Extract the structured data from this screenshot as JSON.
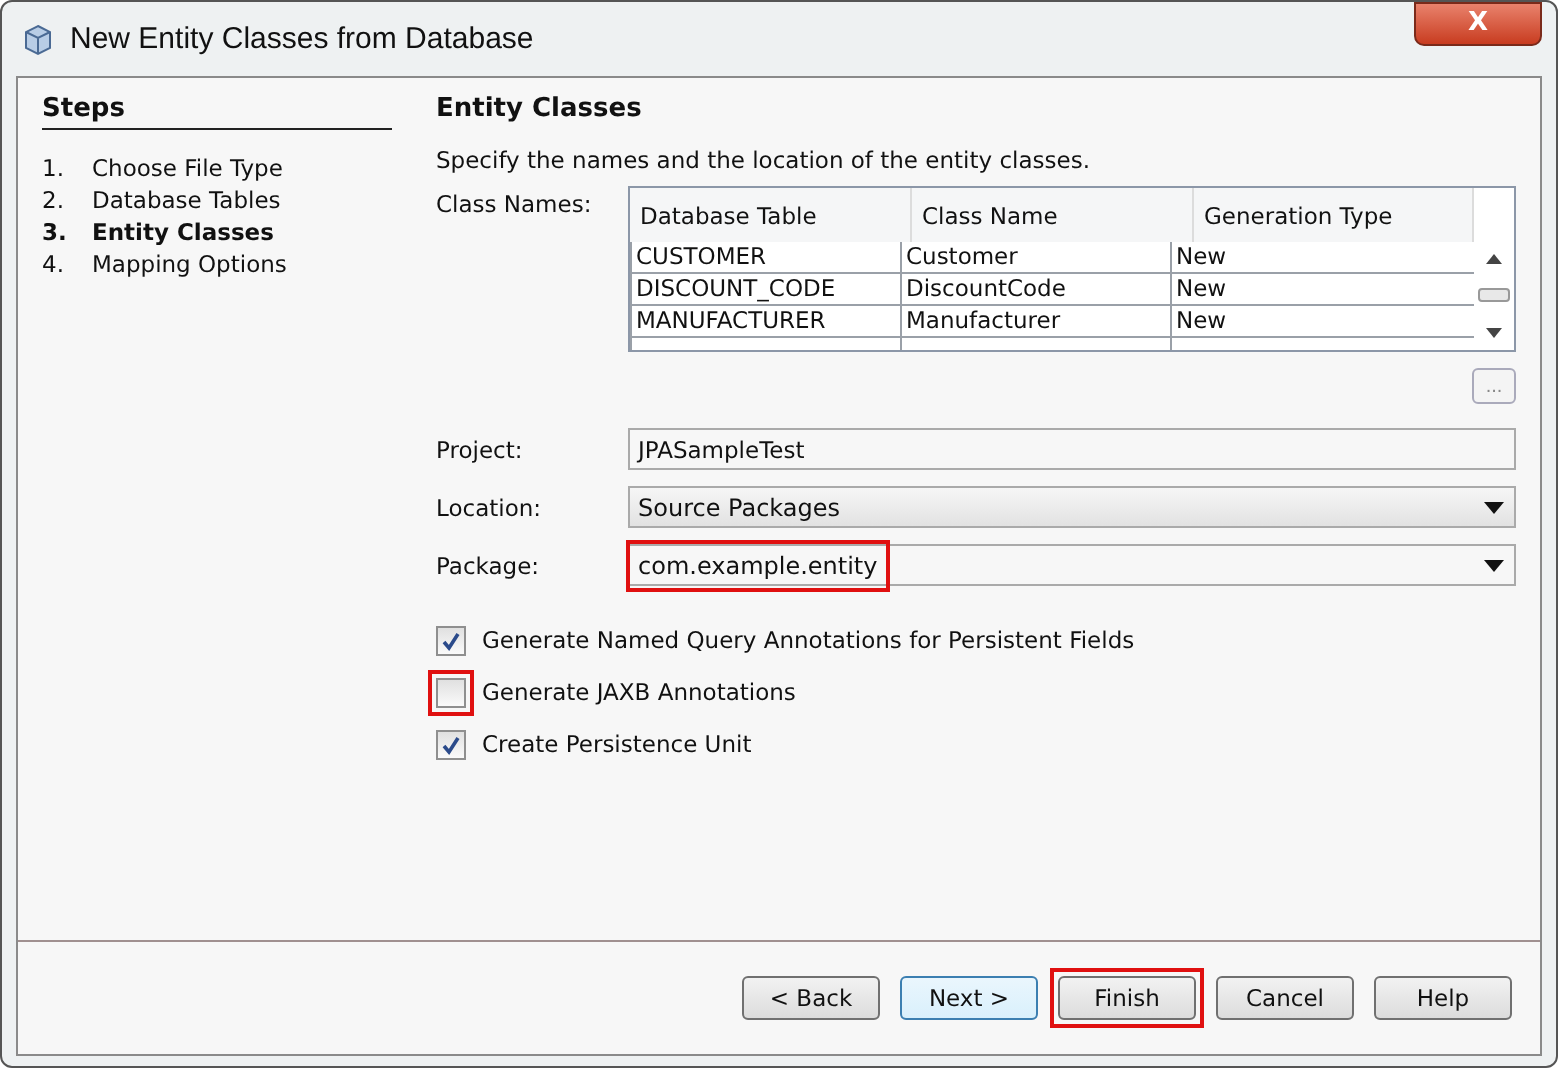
{
  "window": {
    "title": "New Entity Classes from Database",
    "close_label": "X"
  },
  "steps": {
    "title": "Steps",
    "items": [
      {
        "number": "1.",
        "label": "Choose File Type",
        "selected": false
      },
      {
        "number": "2.",
        "label": "Database Tables",
        "selected": false
      },
      {
        "number": "3.",
        "label": "Entity Classes",
        "selected": true
      },
      {
        "number": "4.",
        "label": "Mapping Options",
        "selected": false
      }
    ]
  },
  "content": {
    "title": "Entity Classes",
    "description": "Specify the names and the location of the entity classes.",
    "class_names_label": "Class Names:",
    "table": {
      "columns": [
        "Database Table",
        "Class Name",
        "Generation Type"
      ],
      "rows": [
        [
          "CUSTOMER",
          "Customer",
          "New"
        ],
        [
          "DISCOUNT_CODE",
          "DiscountCode",
          "New"
        ],
        [
          "MANUFACTURER",
          "Manufacturer",
          "New"
        ]
      ]
    },
    "more_button": "...",
    "fields": [
      {
        "kind": "text",
        "label": "Project:",
        "value": "JPASampleTest"
      },
      {
        "kind": "combo",
        "label": "Location:",
        "value": "Source Packages"
      },
      {
        "kind": "editable-combo",
        "label": "Package:",
        "value": "com.example.entity",
        "highlighted": true
      }
    ],
    "checkboxes": [
      {
        "label": "Generate Named Query Annotations for Persistent Fields",
        "checked": true,
        "highlighted": false
      },
      {
        "label": "Generate JAXB Annotations",
        "checked": false,
        "highlighted": true
      },
      {
        "label": "Create Persistence Unit",
        "checked": true,
        "highlighted": false
      }
    ]
  },
  "buttons": [
    {
      "label": "< Back",
      "focused": false,
      "highlighted": false
    },
    {
      "label": "Next >",
      "focused": true,
      "highlighted": false
    },
    {
      "label": "Finish",
      "focused": false,
      "highlighted": true
    },
    {
      "label": "Cancel",
      "focused": false,
      "highlighted": false
    },
    {
      "label": "Help",
      "focused": false,
      "highlighted": false
    }
  ]
}
